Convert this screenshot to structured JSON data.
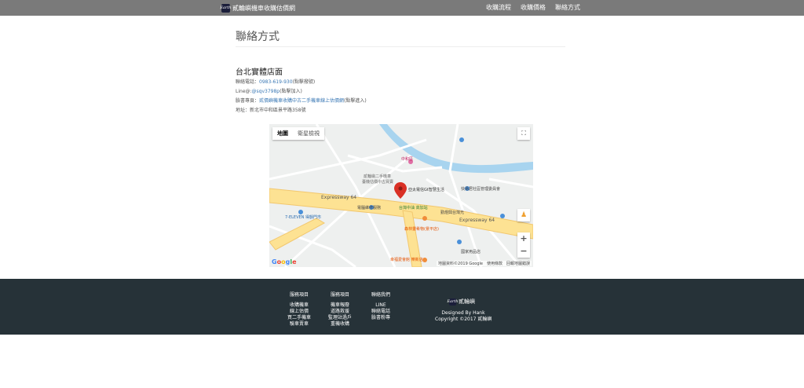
{
  "header": {
    "logo_text": "Earth",
    "site_title": "貳輪嶼機車收購估價網",
    "nav": [
      "收購流程",
      "收購價格",
      "聯絡方式"
    ]
  },
  "page": {
    "title": "聯絡方式",
    "store_name": "台北實體店面",
    "lines": [
      {
        "label": "聯絡電話：",
        "link": "0983-619-930",
        "suffix": "(點擊撥號)"
      },
      {
        "label": "Line@:",
        "link": "@sqv3798p",
        "suffix": "(點擊加入)"
      },
      {
        "label": "臉書專頁：",
        "link": "貳價嶼機車收購中古二手機車線上估價網",
        "suffix": "(點擊進入)"
      },
      {
        "label": "地址：新北市中和區景平路358號",
        "link": "",
        "suffix": ""
      }
    ]
  },
  "map": {
    "tabs": [
      "地圖",
      "衛星檢視"
    ],
    "labels": {
      "expressway1": "Expressway 64",
      "expressway2": "Expressway 64",
      "poi1": "貳輪嶼二手機車",
      "poi2": "臺機估價中古買賣",
      "poi3": "亞太電信Gt智慧生活",
      "poi4": "中和區",
      "poi5": "快易居社區管理委員會",
      "poi6": "電腦維修服務",
      "poi7": "台灣中油 高加站",
      "poi8": "勤煜興台灣光",
      "poi9": "7-ELEVEN 得韻門市",
      "poi10": "森林靈肴物(景平店)",
      "poi11": "國家用品店",
      "poi12": "幸福愛會館 樂新店"
    },
    "google": "Google",
    "attribution": "地圖資料©2019 Google　使用條款　回報地圖錯誤",
    "colors": {
      "road": "#fde293",
      "water": "#a8d4ef",
      "land": "#eef0ef",
      "street": "#ffffff",
      "pin": "#d93025"
    }
  },
  "footer": {
    "columns": [
      {
        "title": "服務項目",
        "items": [
          "收購機車",
          "線上估價",
          "買二手機車",
          "驗車賣車"
        ]
      },
      {
        "title": "服務項目",
        "items": [
          "機車報廢",
          "道路救援",
          "監理站過戶",
          "重機收購"
        ]
      },
      {
        "title": "聯絡我們",
        "items": [
          "LINE",
          "聯絡電話",
          "臉書粉專"
        ]
      }
    ],
    "brand_text": "貳輪嶼",
    "credit": [
      "Designed By Hank",
      "Copyright ©2017 貳輪嶼"
    ]
  }
}
